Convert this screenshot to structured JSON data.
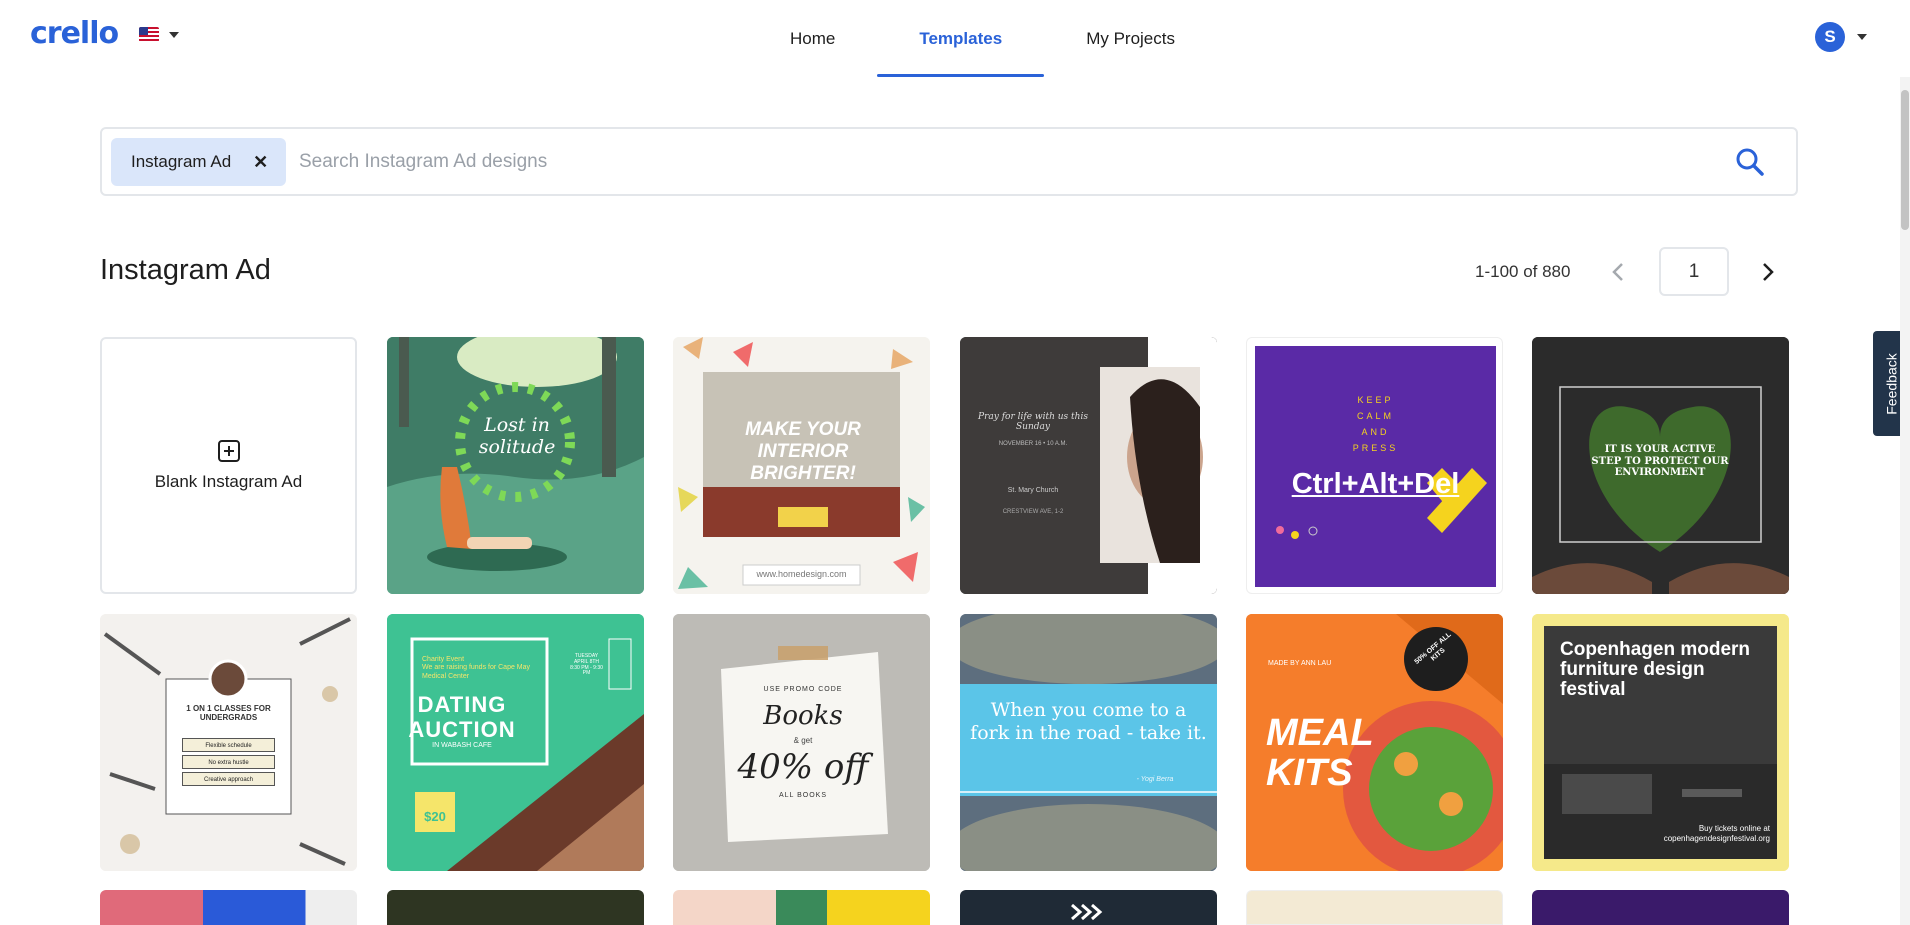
{
  "app": {
    "logo": "crello"
  },
  "nav": {
    "items": [
      "Home",
      "Templates",
      "My Projects"
    ],
    "active": "Templates"
  },
  "user": {
    "initial": "S"
  },
  "search": {
    "chip": "Instagram Ad",
    "placeholder": "Search Instagram Ad designs"
  },
  "page": {
    "title": "Instagram Ad",
    "range": "1-100 of 880",
    "page_number": "1"
  },
  "blank_card": {
    "label": "Blank Instagram Ad"
  },
  "templates": {
    "t1": {
      "text": "Lost in solitude"
    },
    "t2": {
      "text": "MAKE YOUR INTERIOR BRIGHTER!",
      "url": "www.homedesign.com"
    },
    "t3": {
      "line1": "Pray for life with us this Sunday",
      "line2": "NOVEMBER 16 • 10 A.M.",
      "line3": "St. Mary Church",
      "line4": "CRESTVIEW AVE, 1-2"
    },
    "t4": {
      "l1": "KEEP",
      "l2": "CALM",
      "l3": "AND",
      "l4": "PRESS",
      "main": "Ctrl+Alt+Del"
    },
    "t5": {
      "text": "IT IS YOUR ACTIVE STEP TO PROTECT OUR ENVIRONMENT"
    },
    "t6": {
      "title": "1 ON 1 CLASSES FOR UNDERGRADS",
      "items": [
        "Flexible schedule",
        "No extra hustle",
        "Creative approach"
      ]
    },
    "t7": {
      "small": "Charity Event",
      "sub": "We are raising funds for Cape May Medical Center",
      "title": "DATING AUCTION",
      "place": "IN WABASH CAFE",
      "price": "$20",
      "date": "TUESDAY APRIL 8TH 8:30 PM - 9:30 PM"
    },
    "t8": {
      "top": "USE PROMO CODE",
      "script": "Books",
      "amp": "& get",
      "off": "40% off",
      "bottom": "ALL BOOKS"
    },
    "t9": {
      "quote": "When you come to a fork in the road - take it.",
      "author": "- Yogi Berra"
    },
    "t10": {
      "made": "MADE BY ANN LAU",
      "title": "MEAL KITS",
      "badge": "50% OFF ALL KITS"
    },
    "t11": {
      "title": "Copenhagen modern furniture design festival",
      "footer": "Buy tickets online at copenhagendesignfestival.org"
    }
  },
  "feedback": {
    "label": "Feedback"
  },
  "colors": {
    "accent": "#2a62d8",
    "chip_bg": "#dae6fa",
    "feedback_bg": "#22344a"
  }
}
